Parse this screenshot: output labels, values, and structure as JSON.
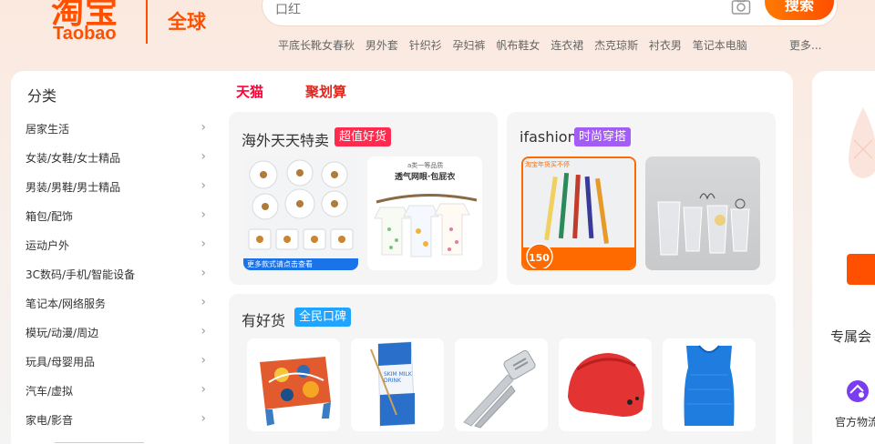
{
  "header": {
    "logo_cn": "淘宝",
    "logo_en": "Taobao",
    "global_label": "全球",
    "search_placeholder": "口红",
    "search_button": "搜索",
    "hot_words": [
      "平底长靴女春秋",
      "男外套",
      "针织衫",
      "孕妇裤",
      "帆布鞋女",
      "连衣裙",
      "杰克琼斯",
      "衬衣男",
      "笔记本电脑"
    ],
    "more": "更多..."
  },
  "sidebar": {
    "title": "分类",
    "items": [
      {
        "label": "居家生活"
      },
      {
        "label": "女装/女鞋/女士精品"
      },
      {
        "label": "男装/男鞋/男士精品"
      },
      {
        "label": "箱包/配饰"
      },
      {
        "label": "运动户外"
      },
      {
        "label": "3C数码/手机/智能设备"
      },
      {
        "label": "笔记本/网络服务"
      },
      {
        "label": "模玩/动漫/周边"
      },
      {
        "label": "玩具/母婴用品"
      },
      {
        "label": "汽车/虚拟"
      },
      {
        "label": "家电/影音"
      }
    ]
  },
  "tabs": {
    "tmall": "天猫",
    "juhuasuan": "聚划算"
  },
  "panels": {
    "overseas": {
      "title": "海外天天特卖",
      "tag": "超值好货",
      "tag_color": "#ff2a4d"
    },
    "ifashion": {
      "title": "ifashion",
      "tag": "时尚穿搭",
      "tag_color": "#a35cf5"
    },
    "goods": {
      "title": "有好货",
      "tag": "全民口碑",
      "tag_color": "#1fa4ff"
    }
  },
  "thumb_text": {
    "lamp_banner": "更多款式请点击查看",
    "clothes_top": "a类一等品质",
    "clothes_title": "透气网眼·包屁衣",
    "pen_banner": "淘宝年货买不停",
    "pen_price": "150",
    "milk_label": "SKIM MILK DRINK"
  },
  "right_panel": {
    "label": "专属会",
    "sub": "官方物流"
  },
  "colors": {
    "brand_orange": "#ff5000",
    "tmall_red": "#ff0036",
    "ju_red": "#e1251b"
  }
}
